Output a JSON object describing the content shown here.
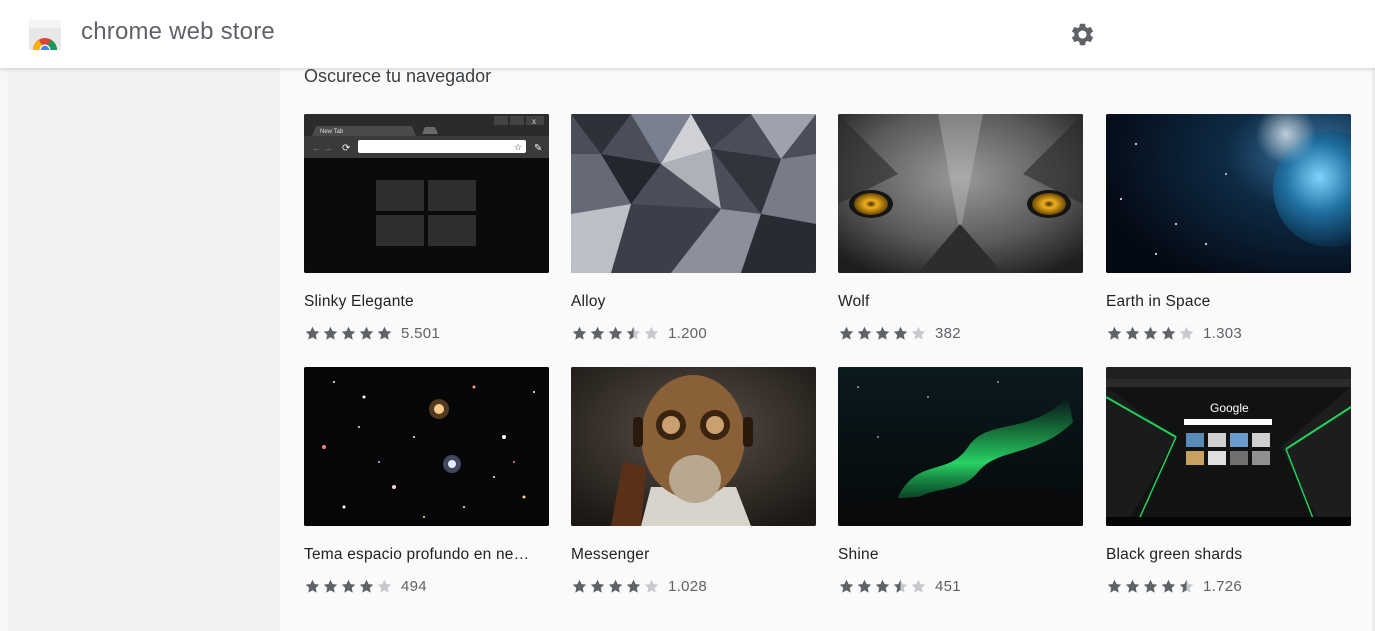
{
  "header": {
    "title": "chrome web store",
    "settings_icon": "gear-icon"
  },
  "section": {
    "title": "Oscurece tu navegador"
  },
  "colors": {
    "star_filled": "#5f6368",
    "star_empty": "#c7c9cc",
    "accent_green": "#1fd15a"
  },
  "themes": [
    {
      "name": "Slinky Elegante",
      "rating": 5,
      "count": "5.501"
    },
    {
      "name": "Alloy",
      "rating": 3.5,
      "count": "1.200"
    },
    {
      "name": "Wolf",
      "rating": 4,
      "count": "382"
    },
    {
      "name": "Earth in Space",
      "rating": 4,
      "count": "1.303"
    },
    {
      "name": "Tema espacio profundo en ne…",
      "rating": 4,
      "count": "494"
    },
    {
      "name": "Messenger",
      "rating": 4,
      "count": "1.028"
    },
    {
      "name": "Shine",
      "rating": 3.5,
      "count": "451"
    },
    {
      "name": "Black green shards",
      "rating": 4.5,
      "count": "1.726"
    }
  ],
  "previews": {
    "slinky": {
      "tab_label": "New Tab"
    },
    "shards": {
      "logo_text": "Google"
    }
  }
}
